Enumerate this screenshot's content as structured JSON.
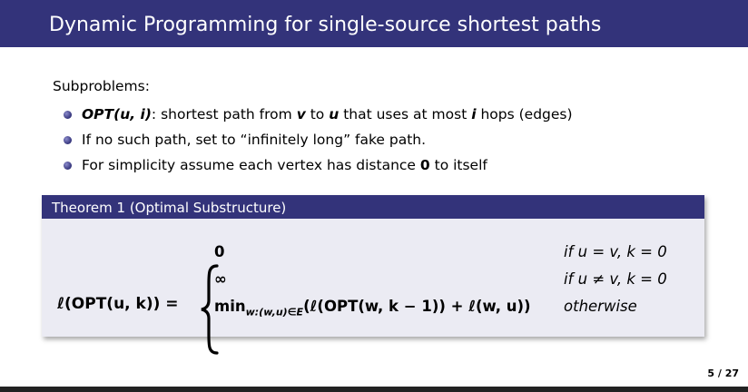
{
  "frame": {
    "title": "Dynamic Programming for single-source shortest paths"
  },
  "content": {
    "intro": "Subproblems:",
    "bullets": [
      {
        "lead": "OPT(u, i)",
        "text_a": ": shortest path from ",
        "v": "v",
        "text_b": " to ",
        "u": "u",
        "text_c": " that uses at most ",
        "i": "i",
        "text_d": " hops (edges)"
      },
      {
        "text": "If no such path, set to “infinitely long” fake path."
      },
      {
        "text_a": "For simplicity assume each vertex has distance ",
        "zero": "0",
        "text_b": " to itself"
      }
    ]
  },
  "theorem": {
    "title": "Theorem 1 (Optimal Substructure)",
    "lhs": "ℓ(OPT(u, k)) =",
    "cases": [
      {
        "value": "0",
        "condition": "if u = v, k = 0"
      },
      {
        "value": "∞",
        "condition": "if u ≠ v, k = 0"
      },
      {
        "value": "min_{w:(w,u)∈E} (ℓ(OPT(w, k − 1)) + ℓ(w, u))",
        "value_main": "min",
        "value_sub": "w:(w,u)∈E",
        "value_rest": "(ℓ(OPT(w, k − 1)) + ℓ(w, u))",
        "condition": "otherwise"
      }
    ]
  },
  "footer": {
    "page": "5 / 27"
  },
  "colors": {
    "title_bar": "#33337a",
    "block_body": "#ebebf3",
    "bullet": "#33337a"
  }
}
